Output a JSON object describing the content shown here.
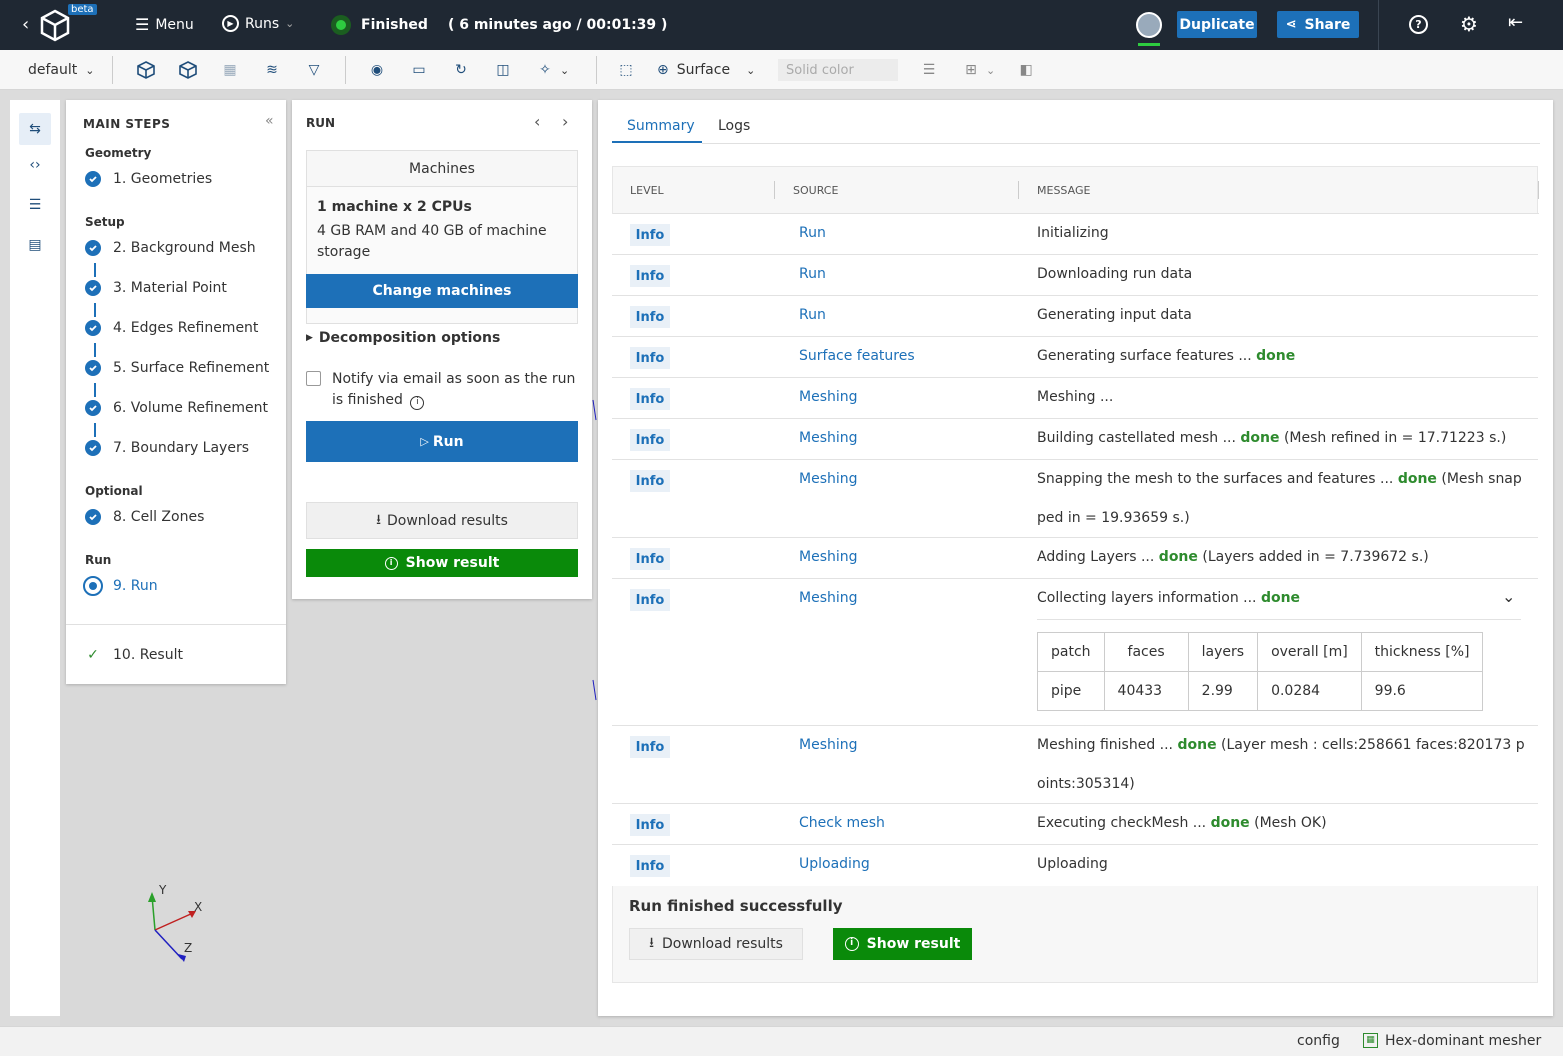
{
  "topbar": {
    "beta_badge": "beta",
    "menu_label": "Menu",
    "runs_label": "Runs",
    "status_label": "Finished",
    "status_time": "( 6 minutes ago / 00:01:39 )",
    "duplicate_label": "Duplicate",
    "share_label": "Share"
  },
  "toolbar": {
    "preset_label": "default",
    "surface_label": "Surface",
    "color_placeholder": "Solid color"
  },
  "steps": {
    "header": "MAIN STEPS",
    "groups": {
      "geometry": "Geometry",
      "setup": "Setup",
      "optional": "Optional",
      "run": "Run"
    },
    "items": [
      {
        "label": "1. Geometries"
      },
      {
        "label": "2. Background Mesh"
      },
      {
        "label": "3. Material Point"
      },
      {
        "label": "4. Edges Refinement"
      },
      {
        "label": "5. Surface Refinement"
      },
      {
        "label": "6. Volume Refinement"
      },
      {
        "label": "7. Boundary Layers"
      },
      {
        "label": "8. Cell Zones"
      },
      {
        "label": "9. Run"
      },
      {
        "label": "10. Result"
      }
    ]
  },
  "run": {
    "title": "RUN",
    "machines_header": "Machines",
    "machine_title": "1 machine x 2 CPUs",
    "machine_desc": "4 GB RAM and 40 GB of machine storage",
    "change_machines": "Change machines",
    "decomposition": "Decomposition options",
    "notify": "Notify via email as soon as the run is finished",
    "run_button": "Run",
    "download": "Download results",
    "show_result": "Show result"
  },
  "logs": {
    "tabs": [
      "Summary",
      "Logs"
    ],
    "columns": [
      "LEVEL",
      "SOURCE",
      "MESSAGE"
    ],
    "rows": [
      {
        "level": "Info",
        "source": "Run",
        "message": "Initializing",
        "done": "",
        "detail": ""
      },
      {
        "level": "Info",
        "source": "Run",
        "message": "Downloading run data",
        "done": "",
        "detail": ""
      },
      {
        "level": "Info",
        "source": "Run",
        "message": "Generating input data",
        "done": "",
        "detail": ""
      },
      {
        "level": "Info",
        "source": "Surface features",
        "message": "Generating surface features ... ",
        "done": "done",
        "detail": ""
      },
      {
        "level": "Info",
        "source": "Meshing",
        "message": "Meshing ...",
        "done": "",
        "detail": ""
      },
      {
        "level": "Info",
        "source": "Meshing",
        "message": "Building castellated mesh ... ",
        "done": "done",
        "detail": " (Mesh refined in = 17.71223 s.)"
      },
      {
        "level": "Info",
        "source": "Meshing",
        "message": "Snapping the mesh to the surfaces and features ... ",
        "done": "done",
        "detail": " (Mesh snapped in = 19.93659 s.)"
      },
      {
        "level": "Info",
        "source": "Meshing",
        "message": "Adding Layers ... ",
        "done": "done",
        "detail": " (Layers added in = 7.739672 s.)"
      },
      {
        "level": "Info",
        "source": "Meshing",
        "message": "Collecting layers information ... ",
        "done": "done",
        "detail": ""
      },
      {
        "level": "Info",
        "source": "Meshing",
        "message": "Meshing finished ... ",
        "done": "done",
        "detail": " (Layer mesh : cells:258661 faces:820173 points:305314)"
      },
      {
        "level": "Info",
        "source": "Check mesh",
        "message": "Executing checkMesh ... ",
        "done": "done",
        "detail": " (Mesh OK)"
      },
      {
        "level": "Info",
        "source": "Uploading",
        "message": "Uploading",
        "done": "",
        "detail": ""
      }
    ],
    "layers_table": {
      "headers": [
        "patch",
        "faces",
        "layers",
        "overall [m]",
        "thickness [%]"
      ],
      "row": [
        "pipe",
        "40433",
        "2.99",
        "0.0284",
        "99.6"
      ]
    },
    "finished_text": "Run finished successfully",
    "download": "Download results",
    "show_result": "Show result"
  },
  "statusbar": {
    "config": "config",
    "mesher": "Hex-dominant mesher"
  },
  "axes": {
    "y": "Y",
    "x": "X",
    "z": "Z"
  },
  "colors": {
    "accent": "#1d70b8",
    "success": "#0a8a0a",
    "topbar": "#1f2833"
  }
}
